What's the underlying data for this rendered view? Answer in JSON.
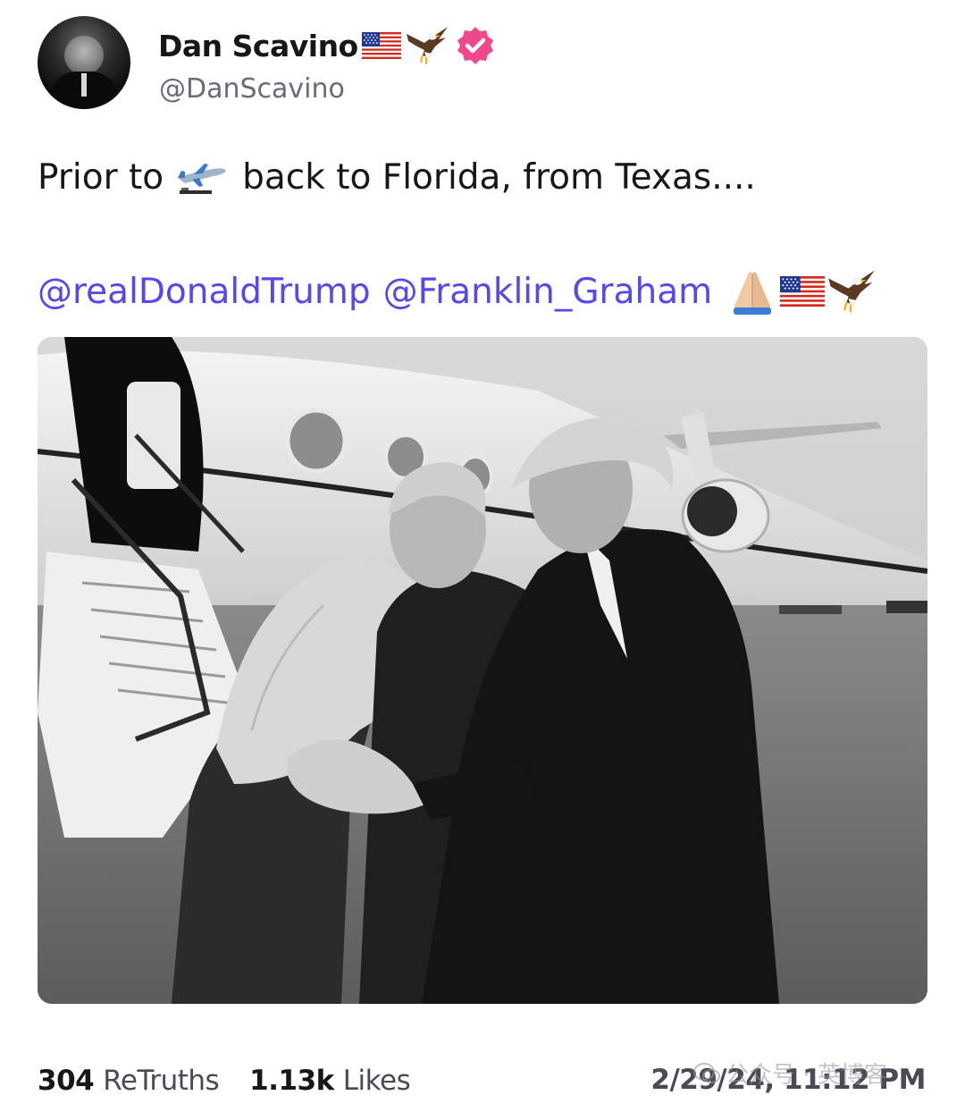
{
  "author": {
    "display_name": "Dan Scavino",
    "handle": "@DanScavino",
    "name_emojis": [
      "us-flag",
      "eagle"
    ],
    "verified": true,
    "verified_color": "#f0478d"
  },
  "post": {
    "text_before": "Prior to",
    "text_after": "back to Florida, from Texas....",
    "inline_emoji": "airplane-departure",
    "mentions": [
      "@realDonaldTrump",
      "@Franklin_Graham"
    ],
    "trailing_emojis": [
      "folded-hands",
      "us-flag",
      "eagle"
    ],
    "mention_color": "#5448ee",
    "image_description_icon": "photo"
  },
  "footer": {
    "retruths_count": "304",
    "retruths_label": "ReTruths",
    "likes_count": "1.13k",
    "likes_label": "Likes",
    "timestamp": "2/29/24, 11:12 PM"
  },
  "watermark": {
    "text": "公众号 · 英博客"
  }
}
